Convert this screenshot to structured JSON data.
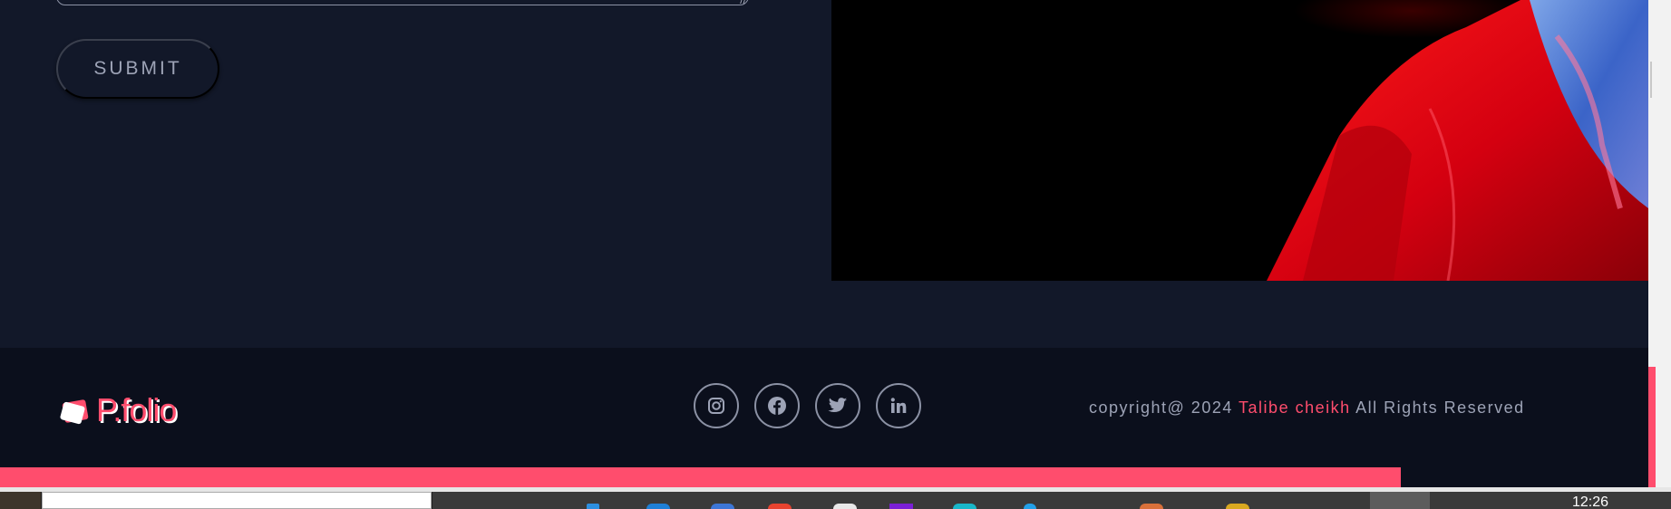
{
  "form": {
    "submit_label": "SUBMIT"
  },
  "footer": {
    "logo_text": "P.folio",
    "social": [
      {
        "icon": "instagram-icon"
      },
      {
        "icon": "facebook-icon"
      },
      {
        "icon": "twitter-icon"
      },
      {
        "icon": "linkedin-icon"
      }
    ],
    "copyright_prefix": "copyright@ 2024",
    "copyright_name": "Talibe cheikh",
    "copyright_suffix": "All Rights Reserved"
  },
  "scroll_progress_percent": 85,
  "taskbar": {
    "clock": "12:26"
  },
  "colors": {
    "background": "#121829",
    "footer": "#0b0f1c",
    "accent": "#ff4d6d",
    "muted_text": "#9da3b6"
  }
}
